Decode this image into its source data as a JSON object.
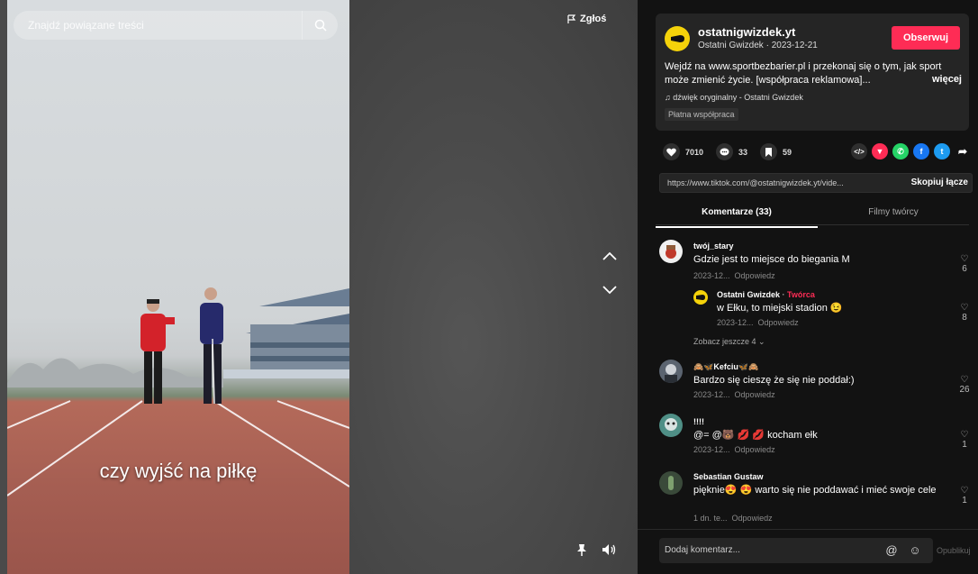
{
  "video": {
    "search_placeholder": "Znajdź powiązane treści",
    "report_label": "Zgłoś",
    "subtitle": "czy wyjść na piłkę"
  },
  "author": {
    "username": "ostatnigwizdek.yt",
    "subline": "Ostatni Gwizdek · 2023-12-21",
    "follow_label": "Obserwuj",
    "description": "Wejdź na www.sportbezbarier.pl i przekonaj się o tym, jak sport może zmienić życie. [współpraca reklamowa]...",
    "more_label": "więcej",
    "music": "dźwięk oryginalny - Ostatni Gwizdek",
    "paid_label": "Płatna współpraca"
  },
  "stats": {
    "likes": "7010",
    "comments": "33",
    "saves": "59"
  },
  "share": {
    "link": "https://www.tiktok.com/@ostatnigwizdek.yt/vide...",
    "copy_label": "Skopiuj łącze"
  },
  "tabs": {
    "comments": "Komentarze (33)",
    "creator_videos": "Filmy twórcy"
  },
  "comments": [
    {
      "name": "twój_stary",
      "text": "Gdzie jest to miejsce do biegania M",
      "date": "2023-12...",
      "reply": "Odpowiedz",
      "likes": "6"
    },
    {
      "name": "Ostatni Gwizdek",
      "badge": "Twórca",
      "text": "w Ełku, to miejski stadion 😉",
      "date": "2023-12...",
      "reply": "Odpowiedz",
      "likes": "8"
    },
    {
      "name": "🙈🦋Kefciu🦋🙈",
      "text": "Bardzo się cieszę że się nie poddał:)",
      "date": "2023-12...",
      "reply": "Odpowiedz",
      "likes": "26"
    },
    {
      "name": "!!!!",
      "text": "@= @🐻 💋 💋 kocham ełk",
      "date": "2023-12...",
      "reply": "Odpowiedz",
      "likes": "1"
    },
    {
      "name": "Sebastian Gustaw",
      "text": "pięknie😍 😍 warto się nie poddawać i mieć swoje cele",
      "date": "1 dn. te...",
      "reply": "Odpowiedz",
      "likes": "1"
    }
  ],
  "view_more": "Zobacz jeszcze 4",
  "comment_box": {
    "placeholder": "Dodaj komentarz...",
    "post_label": "Opublikuj"
  },
  "colors": {
    "accent": "#fe2c55",
    "panel": "#121212",
    "card": "#252525"
  }
}
